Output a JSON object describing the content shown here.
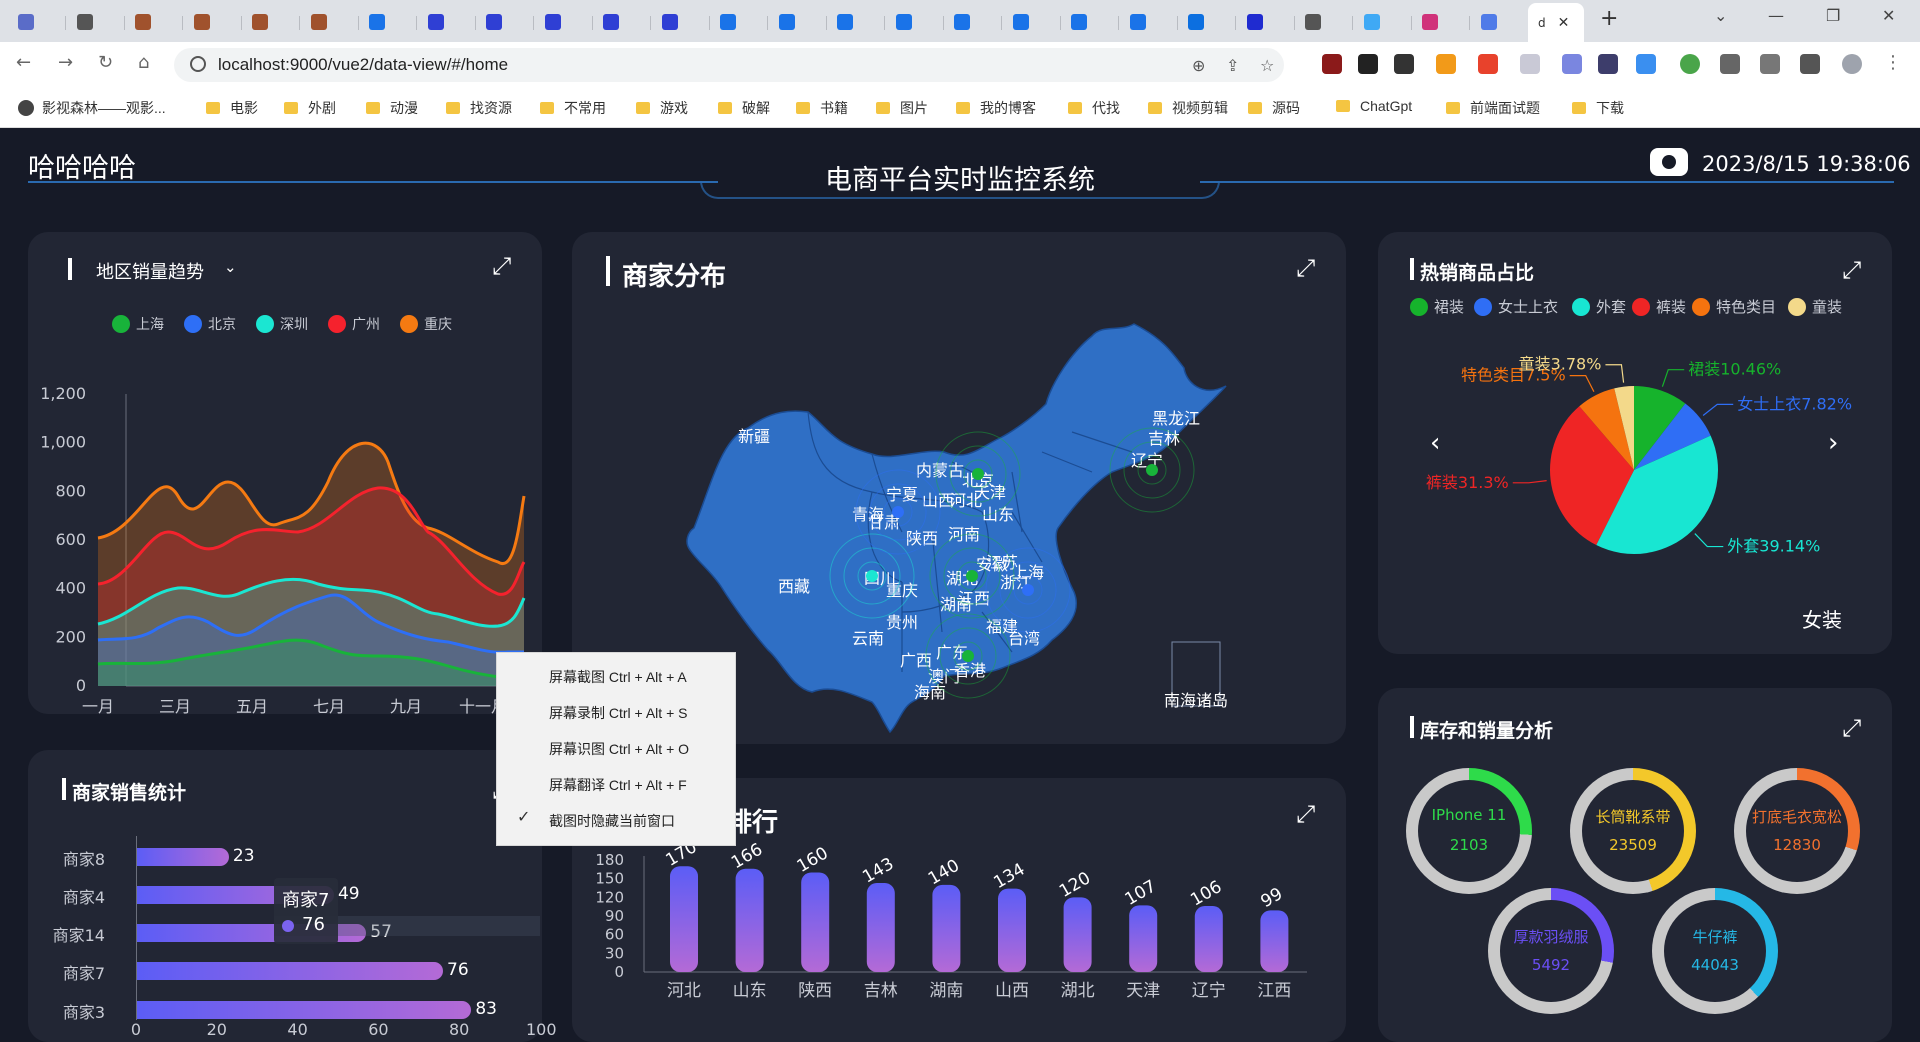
{
  "browser": {
    "active_tab_title": "d",
    "url": "localhost:9000/vue2/data-view/#/home",
    "bookmarks": [
      "影视森林——观影...",
      "电影",
      "外剧",
      "动漫",
      "找资源",
      "不常用",
      "游戏",
      "破解",
      "书籍",
      "图片",
      "我的博客",
      "代找",
      "视频剪辑",
      "源码",
      "ChatGpt",
      "前端面试题",
      "下载"
    ]
  },
  "header": {
    "brand": "哈哈哈哈",
    "title": "电商平台实时监控系统",
    "datetime": "2023/8/15 19:38:06"
  },
  "trend": {
    "title": "地区销量趋势",
    "legend": [
      {
        "name": "上海",
        "color": "#18b33a"
      },
      {
        "name": "北京",
        "color": "#2e6ff6"
      },
      {
        "name": "深圳",
        "color": "#1be6d2"
      },
      {
        "name": "广州",
        "color": "#f5222d"
      },
      {
        "name": "重庆",
        "color": "#f57a12"
      }
    ],
    "yticks": [
      "1,200",
      "1,000",
      "800",
      "600",
      "400",
      "200",
      "0"
    ],
    "xticks": [
      "一月",
      "三月",
      "五月",
      "七月",
      "九月",
      "十一月"
    ]
  },
  "merchant_map": {
    "title": "商家分布",
    "provinces": [
      {
        "name": "新疆"
      },
      {
        "name": "西藏"
      },
      {
        "name": "青海"
      },
      {
        "name": "甘肃"
      },
      {
        "name": "宁夏"
      },
      {
        "name": "内蒙古"
      },
      {
        "name": "黑龙江"
      },
      {
        "name": "吉林"
      },
      {
        "name": "辽宁"
      },
      {
        "name": "北京"
      },
      {
        "name": "天津"
      },
      {
        "name": "河北"
      },
      {
        "name": "山西"
      },
      {
        "name": "山东"
      },
      {
        "name": "河南"
      },
      {
        "name": "陕西"
      },
      {
        "name": "四川"
      },
      {
        "name": "重庆"
      },
      {
        "name": "湖北"
      },
      {
        "name": "安徽"
      },
      {
        "name": "江苏"
      },
      {
        "name": "上海"
      },
      {
        "name": "浙江"
      },
      {
        "name": "江西"
      },
      {
        "name": "湖南"
      },
      {
        "name": "贵州"
      },
      {
        "name": "云南"
      },
      {
        "name": "广西"
      },
      {
        "name": "广东"
      },
      {
        "name": "福建"
      },
      {
        "name": "台湾"
      },
      {
        "name": "香港"
      },
      {
        "name": "澳门"
      },
      {
        "name": "海南"
      },
      {
        "name": "南海诸岛"
      }
    ]
  },
  "hot_goods": {
    "title": "热销商品占比",
    "legend": [
      {
        "name": "裙装",
        "color": "#16b32c"
      },
      {
        "name": "女士上衣",
        "color": "#2f6ef5"
      },
      {
        "name": "外套",
        "color": "#18e6d2"
      },
      {
        "name": "裤装",
        "color": "#ef2525"
      },
      {
        "name": "特色类目",
        "color": "#f5730f"
      },
      {
        "name": "童装",
        "color": "#f3d98a"
      }
    ],
    "slices": [
      {
        "name": "裙装",
        "value": 10.46,
        "label": "裙装10.46%"
      },
      {
        "name": "女士上衣",
        "value": 7.82,
        "label": "女士上衣7.82%"
      },
      {
        "name": "外套",
        "value": 39.14,
        "label": "外套39.14%"
      },
      {
        "name": "裤装",
        "value": 31.3,
        "label": "裤装31.3%"
      },
      {
        "name": "特色类目",
        "value": 7.5,
        "label": "特色类目7.5%"
      },
      {
        "name": "童装",
        "value": 3.78,
        "label": "童装3.78%"
      }
    ],
    "category": "女装",
    "prev": "‹",
    "next": "›"
  },
  "seller_stats": {
    "title": "商家销售统计",
    "rows": [
      {
        "name": "商家8",
        "value": 23
      },
      {
        "name": "商家4",
        "value": 49
      },
      {
        "name": "商家14",
        "value": 57
      },
      {
        "name": "商家7",
        "value": 76
      },
      {
        "name": "商家3",
        "value": 83
      }
    ],
    "xticks": [
      "0",
      "20",
      "40",
      "60",
      "80",
      "100"
    ],
    "tooltip": {
      "name": "商家7",
      "value": "76"
    }
  },
  "region_rank": {
    "title": "地区销售排行",
    "yticks": [
      "180",
      "150",
      "120",
      "90",
      "60",
      "30",
      "0"
    ],
    "bars": [
      {
        "name": "河北",
        "value": 170
      },
      {
        "name": "山东",
        "value": 166
      },
      {
        "name": "陕西",
        "value": 160
      },
      {
        "name": "吉林",
        "value": 143
      },
      {
        "name": "湖南",
        "value": 140
      },
      {
        "name": "山西",
        "value": 134
      },
      {
        "name": "湖北",
        "value": 120
      },
      {
        "name": "天津",
        "value": 107
      },
      {
        "name": "辽宁",
        "value": 106
      },
      {
        "name": "江西",
        "value": 99
      }
    ]
  },
  "stock": {
    "title": "库存和销量分析",
    "items": [
      {
        "name": "IPhone 11",
        "value": "2103",
        "color": "#2edb4a"
      },
      {
        "name": "长筒靴系带",
        "value": "23509",
        "color": "#f3c82a"
      },
      {
        "name": "打底毛衣宽松",
        "value": "12830",
        "color": "#f2712e"
      },
      {
        "name": "厚款羽绒服",
        "value": "5492",
        "color": "#6b4ff5"
      },
      {
        "name": "牛仔裤",
        "value": "44043",
        "color": "#25b8e6"
      }
    ]
  },
  "context_menu": {
    "items": [
      "屏幕截图 Ctrl + Alt + A",
      "屏幕录制 Ctrl + Alt + S",
      "屏幕识图 Ctrl + Alt + O",
      "屏幕翻译 Ctrl + Alt + F",
      "截图时隐藏当前窗口"
    ]
  }
}
